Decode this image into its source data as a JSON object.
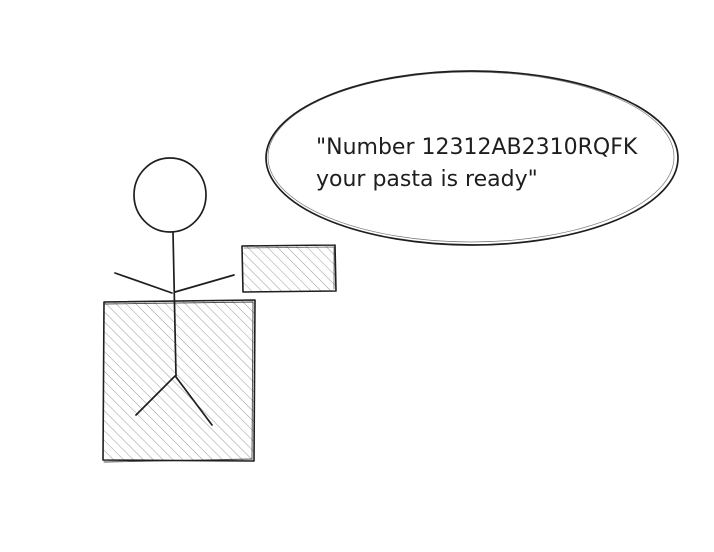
{
  "speech_bubble": {
    "line1": "\"Number 12312AB2310RQFK",
    "line2": "your pasta is ready\""
  },
  "colors": {
    "stroke": "#1e1e1e",
    "hatch": "#9a9a9a",
    "background": "#ffffff"
  }
}
